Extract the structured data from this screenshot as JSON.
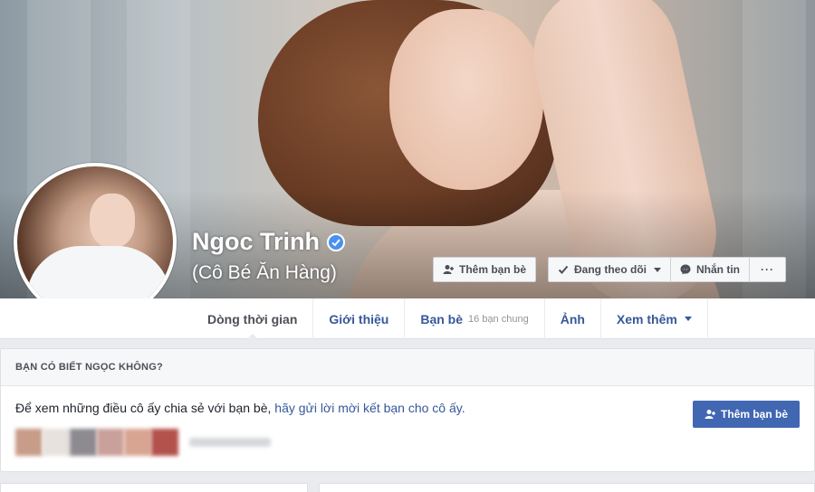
{
  "profile": {
    "name": "Ngoc Trinh",
    "alternate_name": "(Cô Bé Ăn Hàng)",
    "verified": true
  },
  "cover_actions": {
    "add_friend": "Thêm bạn bè",
    "following": "Đang theo dõi",
    "message": "Nhắn tin",
    "more": "···"
  },
  "nav": {
    "timeline": "Dòng thời gian",
    "about": "Giới thiệu",
    "friends": "Bạn bè",
    "friends_mutual": "16 bạn chung",
    "photos": "Ảnh",
    "more": "Xem thêm"
  },
  "know_box": {
    "header": "BẠN CÓ BIẾT NGỌC KHÔNG?",
    "text_prefix": "Để xem những điều cô ấy chia sẻ với bạn bè, ",
    "text_link": "hãy gửi lời mời kết bạn cho cô ấy.",
    "add_friend_button": "Thêm bạn bè"
  },
  "colors": {
    "brand_blue": "#4267b2",
    "link_blue": "#365899",
    "verified_blue": "#4a90f0",
    "page_bg": "#e9ebee"
  }
}
